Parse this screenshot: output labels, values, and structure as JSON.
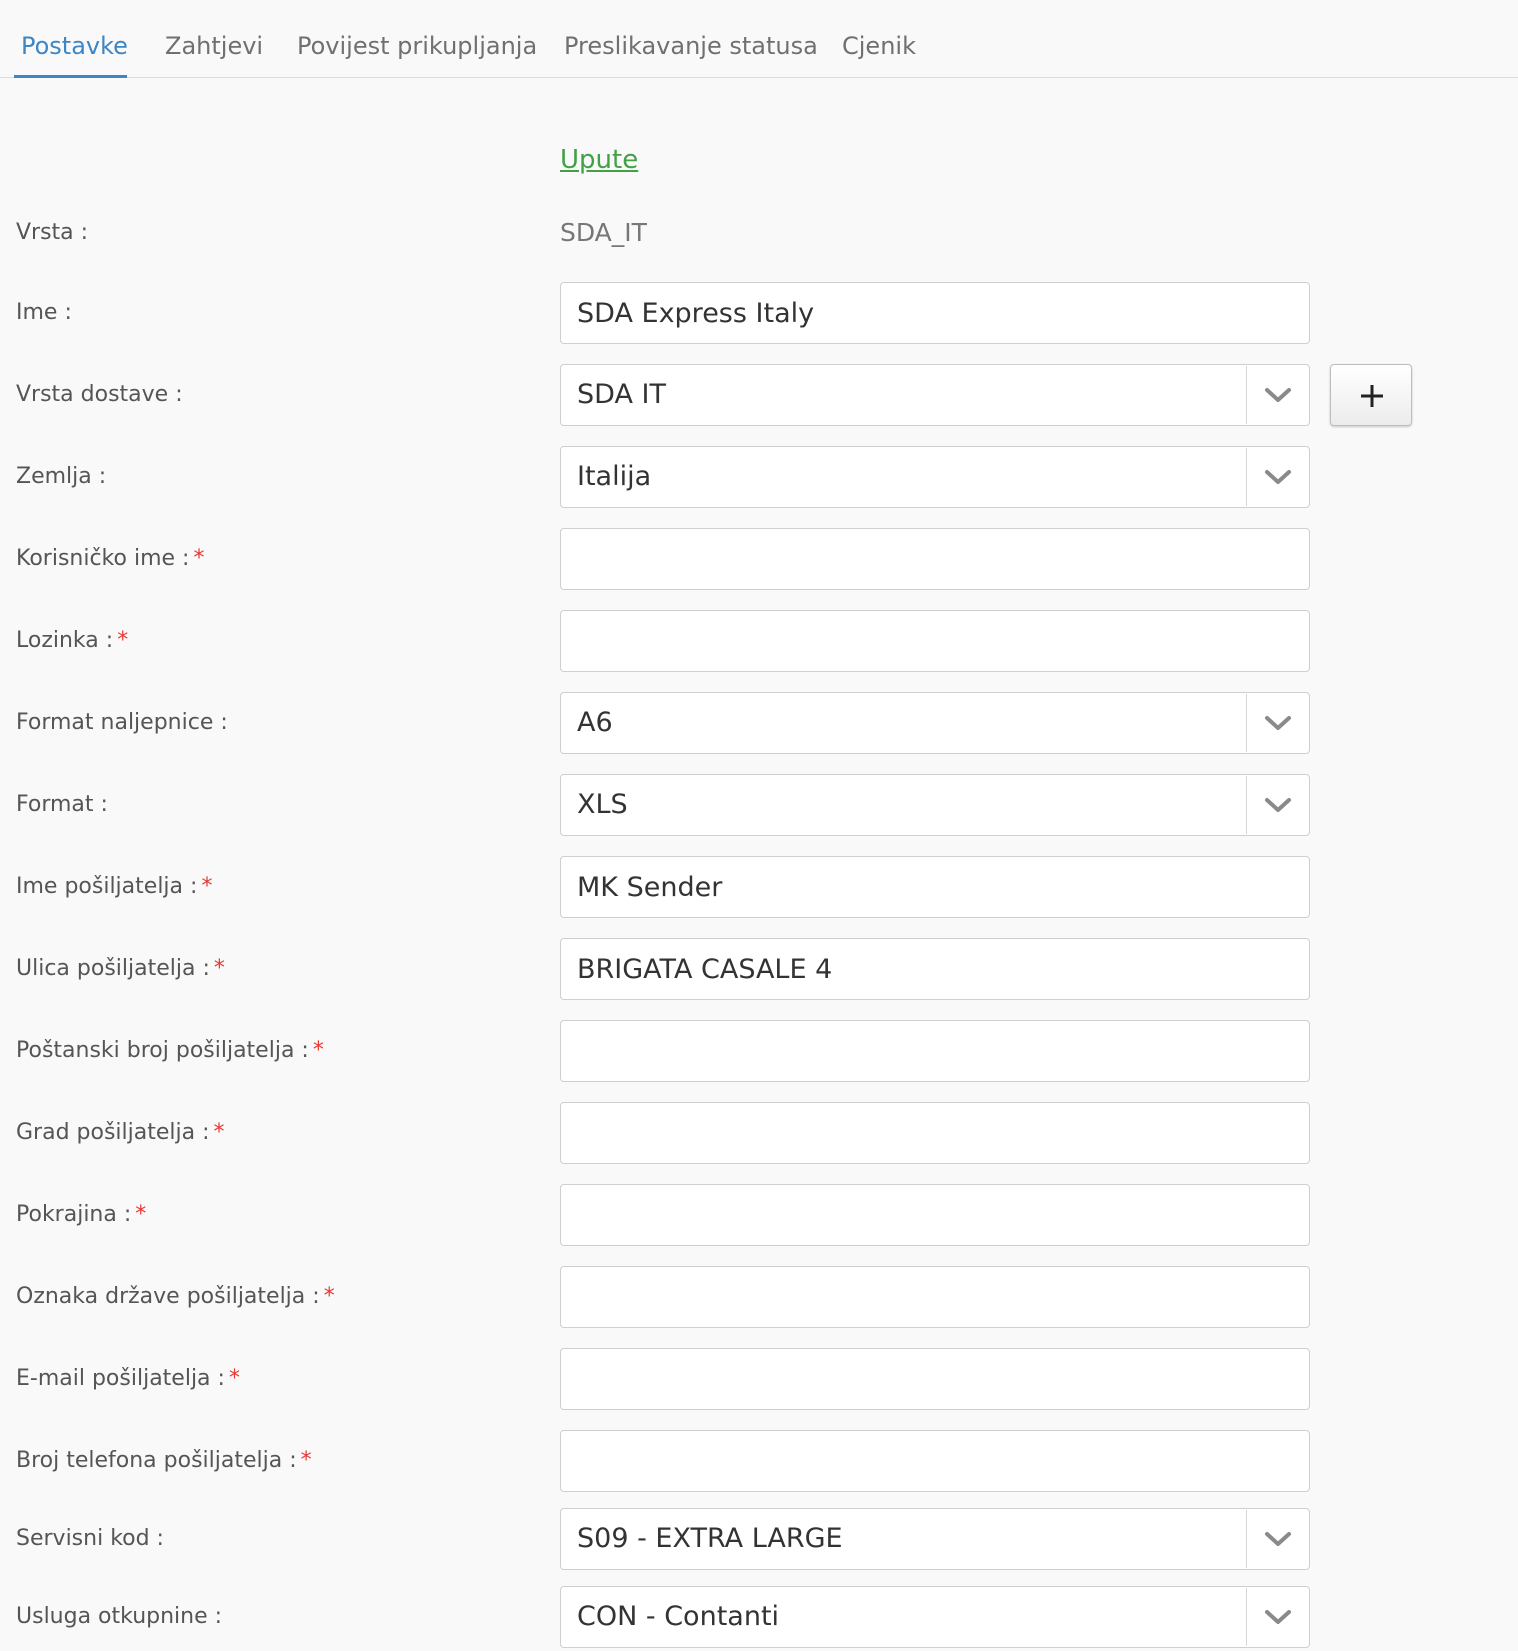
{
  "tabs": [
    {
      "label": "Postavke",
      "active": true
    },
    {
      "label": "Zahtjevi",
      "active": false
    },
    {
      "label": "Povijest prikupljanja",
      "active": false
    },
    {
      "label": "Preslikavanje statusa",
      "active": false
    },
    {
      "label": "Cjenik",
      "active": false
    }
  ],
  "instructions_link": "Upute",
  "form": {
    "type": {
      "label": "Vrsta :",
      "value": "SDA_IT"
    },
    "name": {
      "label": "Ime :",
      "value": "SDA Express Italy"
    },
    "delivery_type": {
      "label": "Vrsta dostave :",
      "value": "SDA IT",
      "add_icon": "plus-icon"
    },
    "country": {
      "label": "Zemlja :",
      "value": "Italija"
    },
    "username": {
      "label": "Korisničko ime :",
      "required": "*",
      "value": ""
    },
    "password": {
      "label": "Lozinka :",
      "required": "*",
      "value": ""
    },
    "label_format": {
      "label": "Format naljepnice :",
      "value": "A6"
    },
    "format": {
      "label": "Format :",
      "value": "XLS"
    },
    "sender_name": {
      "label": "Ime pošiljatelja :",
      "required": "*",
      "value": "MK Sender"
    },
    "sender_street": {
      "label": "Ulica pošiljatelja :",
      "required": "*",
      "value": "BRIGATA CASALE 4"
    },
    "sender_postal": {
      "label": "Poštanski broj pošiljatelja :",
      "required": "*",
      "value": ""
    },
    "sender_city": {
      "label": "Grad pošiljatelja :",
      "required": "*",
      "value": ""
    },
    "province": {
      "label": "Pokrajina :",
      "required": "*",
      "value": ""
    },
    "sender_country_code": {
      "label": "Oznaka države pošiljatelja :",
      "required": "*",
      "value": ""
    },
    "sender_email": {
      "label": "E-mail pošiljatelja :",
      "required": "*",
      "value": ""
    },
    "sender_phone": {
      "label": "Broj telefona pošiljatelja :",
      "required": "*",
      "value": ""
    },
    "service_code": {
      "label": "Servisni kod :",
      "value": "S09 - EXTRA LARGE"
    },
    "cod_service": {
      "label": "Usluga otkupnine :",
      "value": "CON - Contanti"
    }
  },
  "colors": {
    "accent": "#3d86c6",
    "link": "#43a047",
    "required": "#e53935",
    "background": "#f9f9f9"
  }
}
